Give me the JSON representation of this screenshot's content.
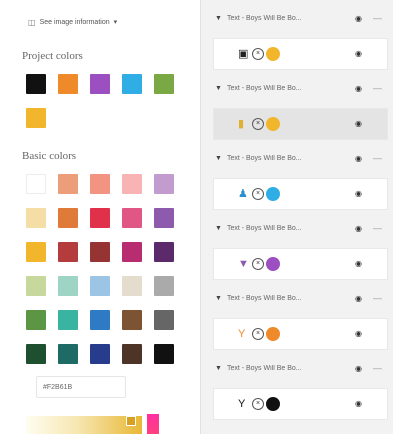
{
  "image_info": {
    "icon": "image-info-icon",
    "label": "See image information",
    "caret": "▾"
  },
  "project_colors": {
    "title": "Project colors",
    "swatches": [
      "#111111",
      "#ee8a2a",
      "#9b4fc0",
      "#2faee6",
      "#7aa845",
      "#f2b62d"
    ]
  },
  "basic_colors": {
    "title": "Basic colors",
    "rows": [
      [
        "#ffffff",
        "#ec9d7a",
        "#f39483",
        "#f8b4b4",
        "#c39ccf"
      ],
      [
        "#f4dea6",
        "#e07a38",
        "#e0304a",
        "#e05684",
        "#8e5aae"
      ],
      [
        "#f2b62d",
        "#b43c3c",
        "#963434",
        "#b82c70",
        "#5c2a6a"
      ],
      [
        "#c8d89c",
        "#9ed4c4",
        "#9cc4e4",
        "#e4dccc",
        "#aaaaaa"
      ],
      [
        "#5c9644",
        "#38b4a0",
        "#2e7ac4",
        "#7c5434",
        "#666666"
      ],
      [
        "#1e5030",
        "#1e6a64",
        "#283c8e",
        "#4e3426",
        "#111111"
      ]
    ]
  },
  "hex_value": "#F2B61B",
  "layers": {
    "group_label": "Text - Boys Will Be Bo...",
    "eye_icon": "◉",
    "items": [
      {
        "icon_char": "▣",
        "icon_color": "#222222",
        "dot_color": "#f2b62d",
        "selected": false
      },
      {
        "icon_char": "▮",
        "icon_color": "#e0b030",
        "dot_color": "#f2b62d",
        "selected": true
      },
      {
        "icon_char": "♟",
        "icon_color": "#2a8ecf",
        "dot_color": "#2faee6",
        "selected": false
      },
      {
        "icon_char": "▼",
        "icon_color": "#8e5aae",
        "dot_color": "#9b4fc0",
        "selected": false
      },
      {
        "icon_char": "Y",
        "icon_color": "#ee8a2a",
        "dot_color": "#ee8a2a",
        "selected": false
      },
      {
        "icon_char": "Y",
        "icon_color": "#111111",
        "dot_color": "#111111",
        "selected": false
      }
    ]
  }
}
